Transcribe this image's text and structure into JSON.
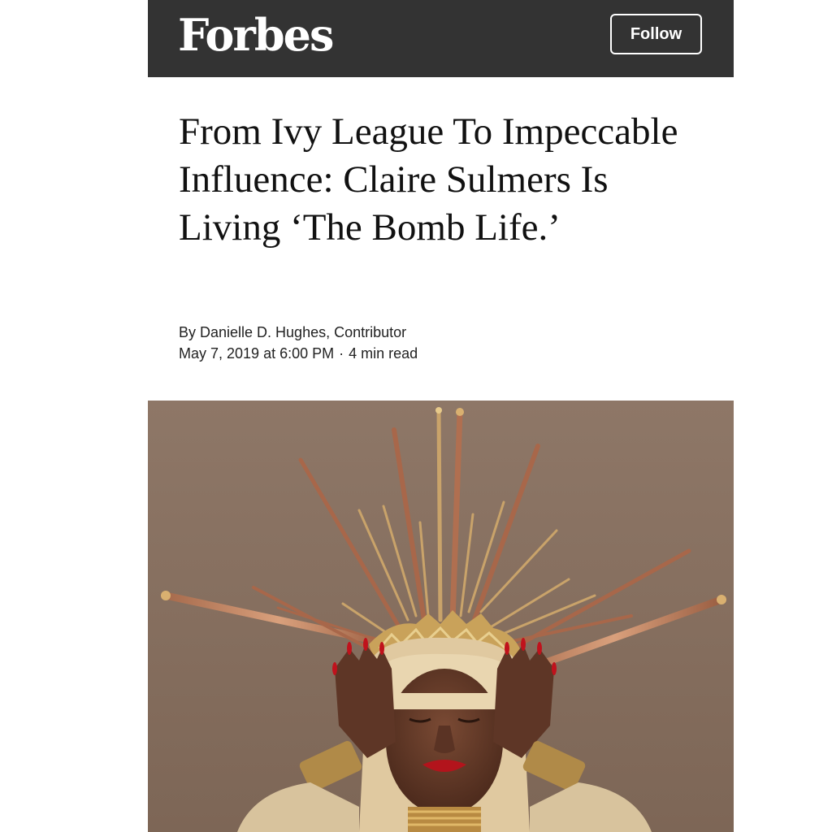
{
  "header": {
    "logo_text": "Forbes",
    "follow_label": "Follow",
    "background_color": "#333333"
  },
  "article": {
    "headline": "From Ivy League To Impeccable Influence: Claire Sulmers Is Living ‘The Bomb Life.’",
    "byline": "By Danielle D. Hughes, Contributor",
    "date": "May 7, 2019 at 6:00 PM",
    "separator": "·",
    "read_time": "4 min read"
  },
  "hero_image": {
    "background_color": "#8b7463"
  }
}
